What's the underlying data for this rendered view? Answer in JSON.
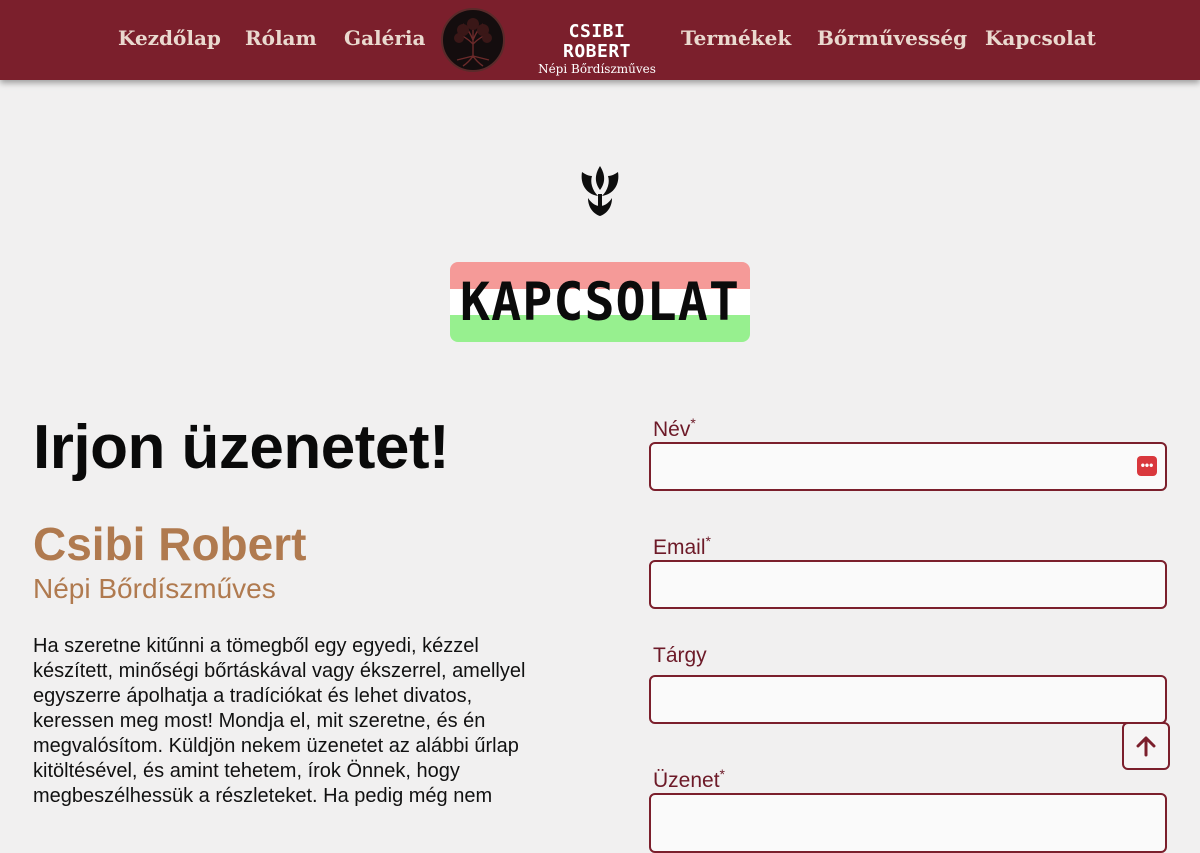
{
  "nav": {
    "items": [
      "Kezdőlap",
      "Rólam",
      "Galéria",
      "Termékek",
      "Bőrművesség",
      "Kapcsolat"
    ],
    "brand_name": "CSIBI ROBERT",
    "brand_subtitle": "Népi Bőrdíszműves"
  },
  "hero": {
    "title": "KAPCSOLAT",
    "flag_colors": [
      "#f59a98",
      "#ffffff",
      "#97f08f"
    ]
  },
  "intro": {
    "heading": "Irjon üzenetet!",
    "name": "Csibi Robert",
    "subtitle": "Népi Bőrdíszműves",
    "text": "Ha szeretne kitűnni a tömegből egy egyedi, kézzel készített, minőségi bőrtáskával vagy ékszerrel, amellyel egyszerre ápolhatja a tradíciókat és lehet divatos, keressen meg most! Mondja el, mit szeretne, és én megvalósítom. Küldjön nekem üzenetet az alábbi űrlap kitöltésével, és amint tehetem, írok Önnek, hogy megbeszélhessük a részleteket. Ha pedig még nem"
  },
  "form": {
    "name_label": "Név",
    "email_label": "Email",
    "subject_label": "Tárgy",
    "message_label": "Üzenet",
    "required_mark": "*",
    "name_value": "",
    "email_value": "",
    "subject_value": ""
  },
  "colors": {
    "brand": "#7b1f2c",
    "accent": "#b07a4f",
    "background": "#f1f0f0"
  },
  "icons": {
    "logo": "tree-of-life-icon",
    "ornament": "tulip-ornament-icon",
    "password_manager": "password-manager-icon",
    "back_to_top": "arrow-up-icon"
  }
}
